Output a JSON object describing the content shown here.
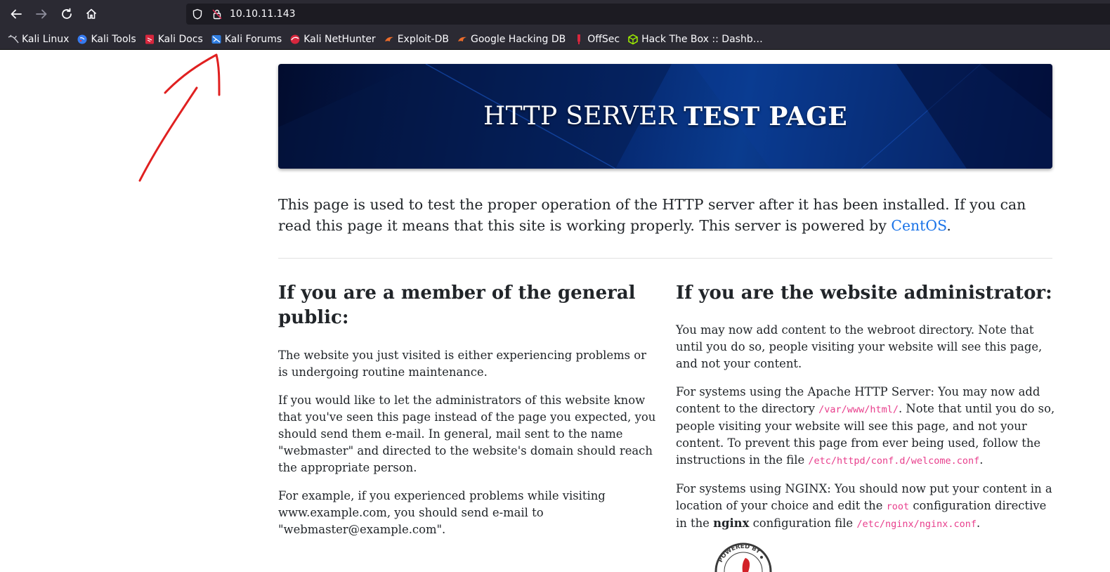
{
  "browser": {
    "url": "10.10.11.143",
    "bookmarks": [
      {
        "label": "Kali Linux",
        "icon": "kali-dragon-icon"
      },
      {
        "label": "Kali Tools",
        "icon": "kali-tools-icon"
      },
      {
        "label": "Kali Docs",
        "icon": "kali-docs-icon"
      },
      {
        "label": "Kali Forums",
        "icon": "kali-forums-icon"
      },
      {
        "label": "Kali NetHunter",
        "icon": "kali-nethunter-icon"
      },
      {
        "label": "Exploit-DB",
        "icon": "exploit-db-icon"
      },
      {
        "label": "Google Hacking DB",
        "icon": "ghdb-icon"
      },
      {
        "label": "OffSec",
        "icon": "offsec-icon"
      },
      {
        "label": "Hack The Box :: Dashb…",
        "icon": "hackthebox-icon"
      }
    ]
  },
  "banner": {
    "title_regular": "HTTP SERVER",
    "title_bold": "TEST PAGE"
  },
  "intro": {
    "text": "This page is used to test the proper operation of the HTTP server after it has been installed. If you can read this page it means that this site is working properly. This server is powered by ",
    "link": "CentOS",
    "end": "."
  },
  "left": {
    "heading": "If you are a member of the general public:",
    "p1": "The website you just visited is either experiencing problems or is undergoing routine maintenance.",
    "p2": "If you would like to let the administrators of this website know that you've seen this page instead of the page you expected, you should send them e-mail. In general, mail sent to the name \"webmaster\" and directed to the website's domain should reach the appropriate person.",
    "p3": "For example, if you experienced problems while visiting www.example.com, you should send e-mail to \"webmaster@example.com\"."
  },
  "right": {
    "heading": "If you are the website administrator:",
    "p1": "You may now add content to the webroot directory. Note that until you do so, people visiting your website will see this page, and not your content.",
    "p2_a": "For systems using the Apache HTTP Server: You may now add content to the directory ",
    "p2_code1": "/var/www/html/",
    "p2_b": ". Note that until you do so, people visiting your website will see this page, and not your content. To prevent this page from ever being used, follow the instructions in the file ",
    "p2_code2": "/etc/httpd/conf.d/welcome.conf",
    "p2_c": ".",
    "p3_a": "For systems using NGINX: You should now put your content in a location of your choice and edit the ",
    "p3_code1": "root",
    "p3_b": " configuration directive in the ",
    "p3_bold": "nginx",
    "p3_c": " configuration file ",
    "p3_code2": "/etc/nginx/nginx.conf",
    "p3_d": ".",
    "badge_text": "POWERED BY"
  },
  "colors": {
    "chrome": "#2b2a33",
    "link": "#1a73e8",
    "code": "#e83e8c",
    "annotation": "#e02020"
  }
}
